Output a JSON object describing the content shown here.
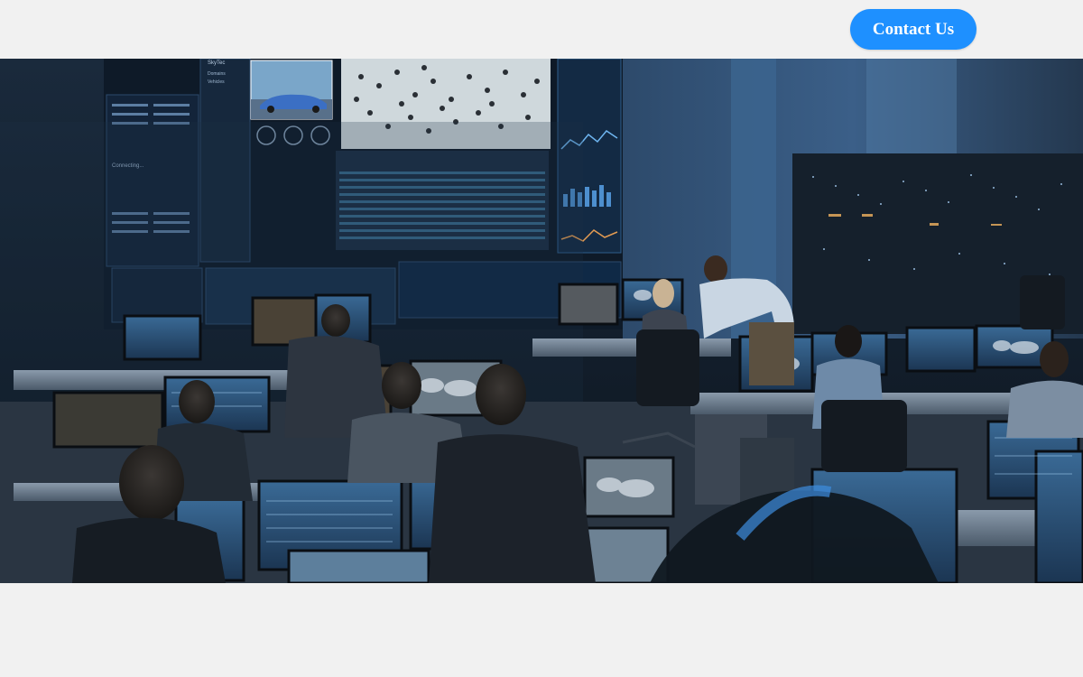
{
  "header": {
    "contact_button_label": "Contact Us"
  },
  "hero": {
    "image_alt": "Control room with operators at workstations in front of a large video wall",
    "wall_screen_texts": [
      "Connecting...",
      "SkyTec",
      "Domains",
      "Vehicles"
    ]
  },
  "colors": {
    "page_background": "#f1f1f1",
    "button_background": "#1e90ff",
    "button_text": "#ffffff",
    "hero_tint": "#1c2e44"
  }
}
